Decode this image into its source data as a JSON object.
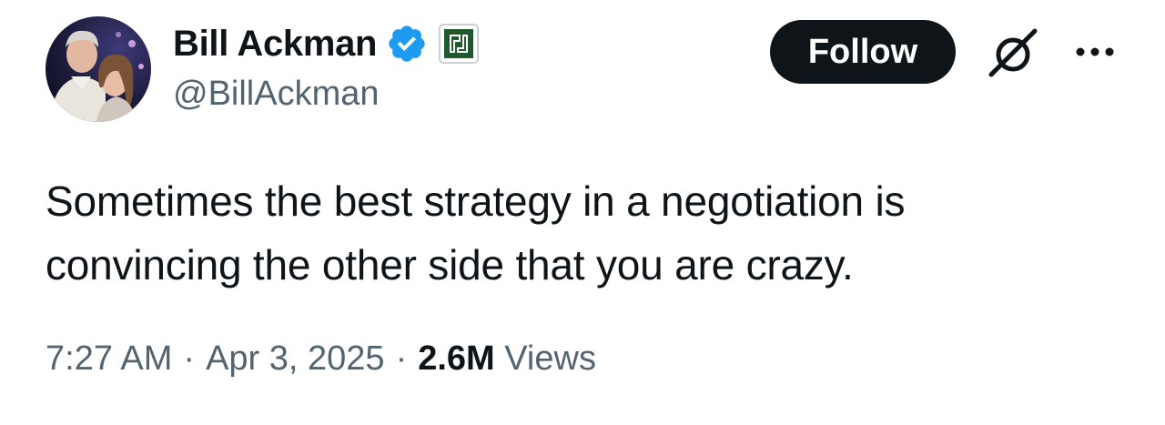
{
  "author": {
    "display_name": "Bill Ackman",
    "handle": "@BillAckman",
    "verified": true,
    "avatar_icon": "profile-photo"
  },
  "actions": {
    "follow_label": "Follow",
    "grok_icon": "grok-icon",
    "more_icon": "more-options-icon"
  },
  "tweet": {
    "text_lines": [
      "Sometimes the best strategy in a negotiation is",
      "convincing the other side that you are crazy."
    ]
  },
  "meta": {
    "time": "7:27 AM",
    "separator": "·",
    "date": "Apr 3, 2025",
    "views_count": "2.6M",
    "views_label": "Views"
  },
  "colors": {
    "primary_text": "#0f1419",
    "secondary_text": "#536471",
    "verified_blue": "#1d9bf0",
    "follow_bg": "#0f1419",
    "affiliate_green": "#1f5a2c"
  }
}
